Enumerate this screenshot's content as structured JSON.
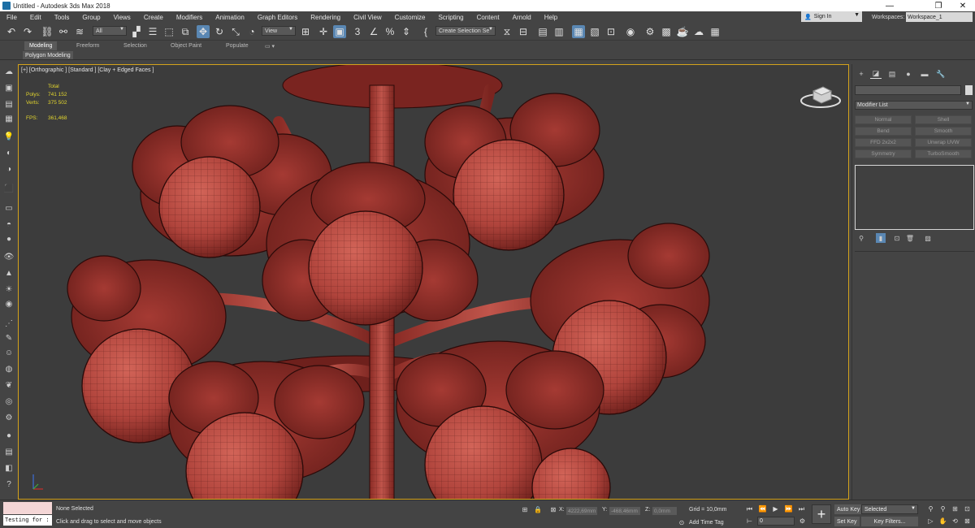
{
  "window": {
    "title": "Untitled - Autodesk 3ds Max 2018",
    "minimize": "—",
    "maximize": "❐",
    "close": "✕"
  },
  "menu": [
    "File",
    "Edit",
    "Tools",
    "Group",
    "Views",
    "Create",
    "Modifiers",
    "Animation",
    "Graph Editors",
    "Rendering",
    "Civil View",
    "Customize",
    "Scripting",
    "Content",
    "Arnold",
    "Help"
  ],
  "account": {
    "signin": "Sign In",
    "workspaces_label": "Workspaces:",
    "workspace": "Workspace_1"
  },
  "toolbar": {
    "selection_filter": "All",
    "ref_coord": "View",
    "selection_set": "Create Selection Se"
  },
  "ribbon": {
    "tabs": [
      "Modeling",
      "Freeform",
      "Selection",
      "Object Paint",
      "Populate"
    ],
    "panel": "Polygon Modeling"
  },
  "viewport": {
    "label": "[+] [Orthographic ] [Standard ] [Clay + Edged Faces ]",
    "stats_header": "Total",
    "polys_label": "Polys:",
    "polys": "741 152",
    "verts_label": "Verts:",
    "verts": "375 502",
    "fps_label": "FPS:",
    "fps": "361,468"
  },
  "command_panel": {
    "modifier_list": "Modifier List",
    "modifiers": [
      "Normal",
      "Shell",
      "Bend",
      "Smooth",
      "FFD 2x2x2",
      "Unwrap UVW",
      "Symmetry",
      "TurboSmooth"
    ]
  },
  "status": {
    "maxscript": "Testing for :",
    "selection": "None Selected",
    "prompt": "Click and drag to select and move objects",
    "x_label": "X:",
    "x": "4222,69mm",
    "y_label": "Y:",
    "y": "-468,46mm",
    "z_label": "Z:",
    "z": "0,0mm",
    "grid": "Grid = 10,0mm",
    "add_time_tag": "Add Time Tag",
    "frame": "0",
    "auto_key": "Auto Key",
    "set_key": "Set Key",
    "selected": "Selected",
    "key_filters": "Key Filters..."
  }
}
